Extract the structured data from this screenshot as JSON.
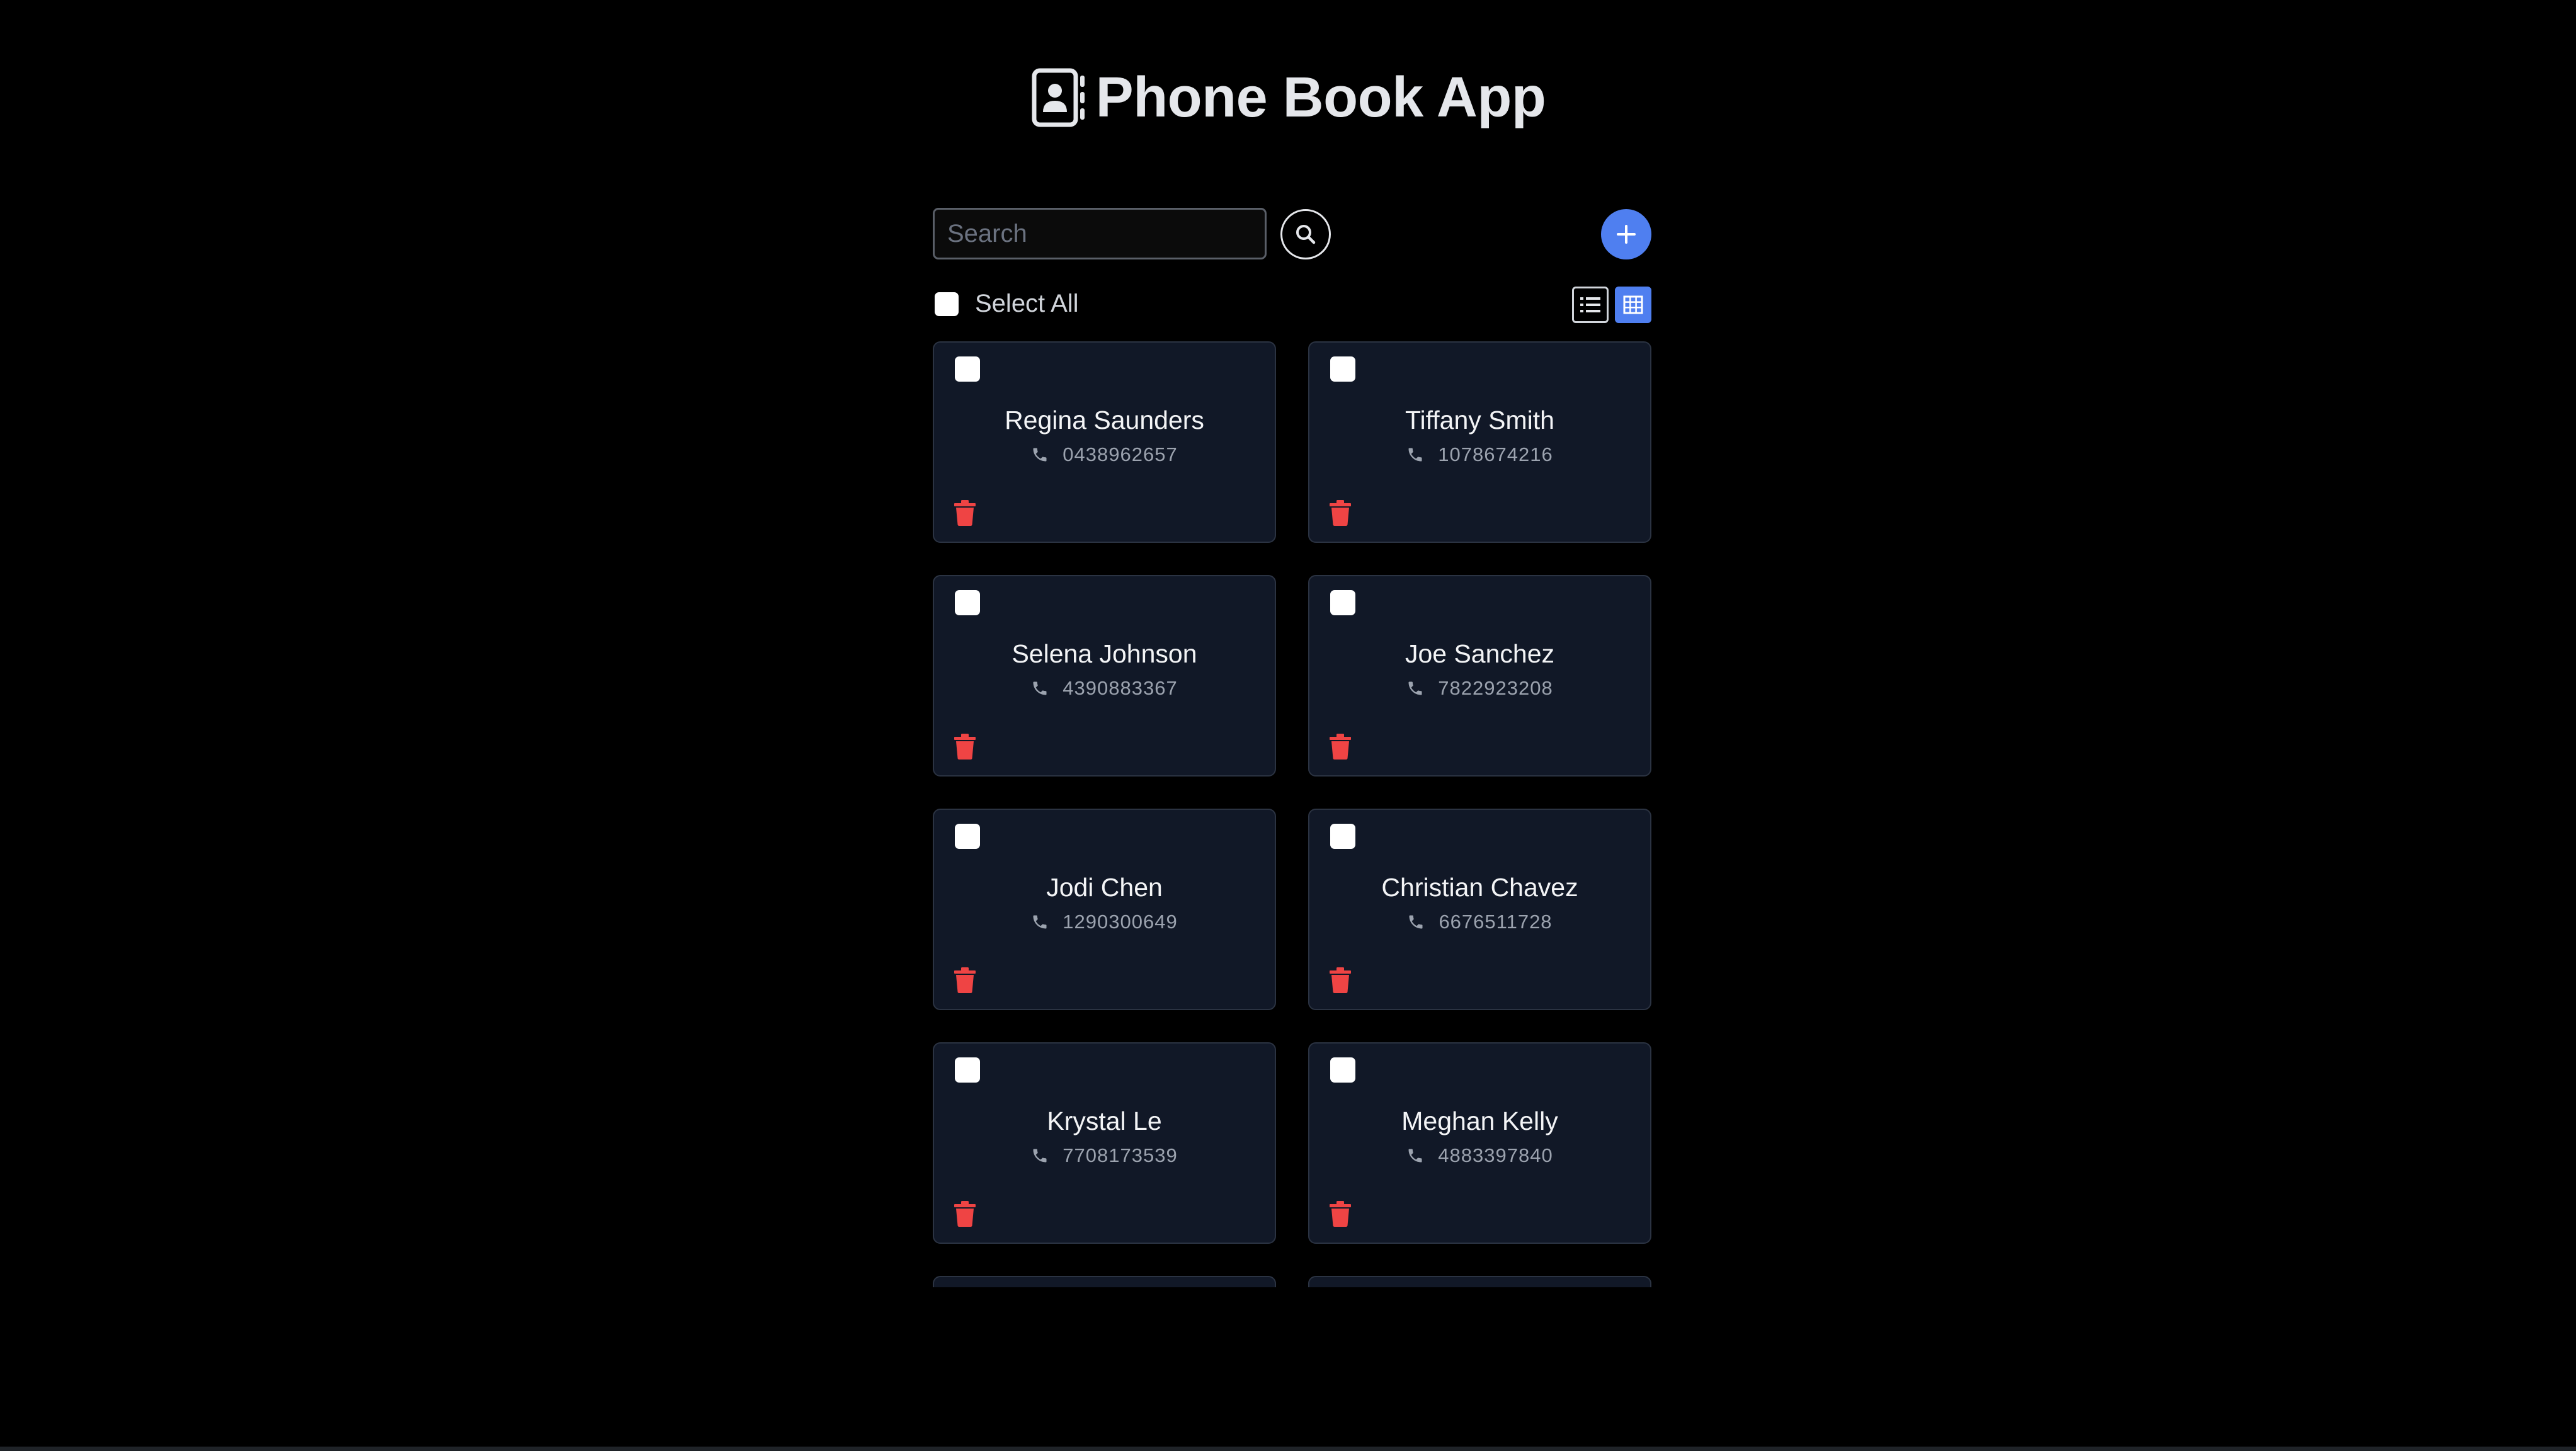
{
  "app": {
    "title": "Phone Book App"
  },
  "toolbar": {
    "search_placeholder": "Search",
    "search_value": "",
    "search_icon": "magnifier-icon",
    "add_icon": "plus-icon"
  },
  "selection": {
    "select_all_label": "Select All",
    "select_all_checked": false
  },
  "view": {
    "active": "grid",
    "list_icon": "list-view-icon",
    "grid_icon": "grid-view-icon"
  },
  "colors": {
    "accent": "#4f7ff0",
    "card_bg": "#111827",
    "delete": "#ef4444",
    "background": "#000000"
  },
  "contacts": [
    {
      "name": "Regina Saunders",
      "phone": "0438962657",
      "checked": false
    },
    {
      "name": "Tiffany Smith",
      "phone": "1078674216",
      "checked": false
    },
    {
      "name": "Selena Johnson",
      "phone": "4390883367",
      "checked": false
    },
    {
      "name": "Joe Sanchez",
      "phone": "7822923208",
      "checked": false
    },
    {
      "name": "Jodi Chen",
      "phone": "1290300649",
      "checked": false
    },
    {
      "name": "Christian Chavez",
      "phone": "6676511728",
      "checked": false
    },
    {
      "name": "Krystal Le",
      "phone": "7708173539",
      "checked": false
    },
    {
      "name": "Meghan Kelly",
      "phone": "4883397840",
      "checked": false
    }
  ]
}
